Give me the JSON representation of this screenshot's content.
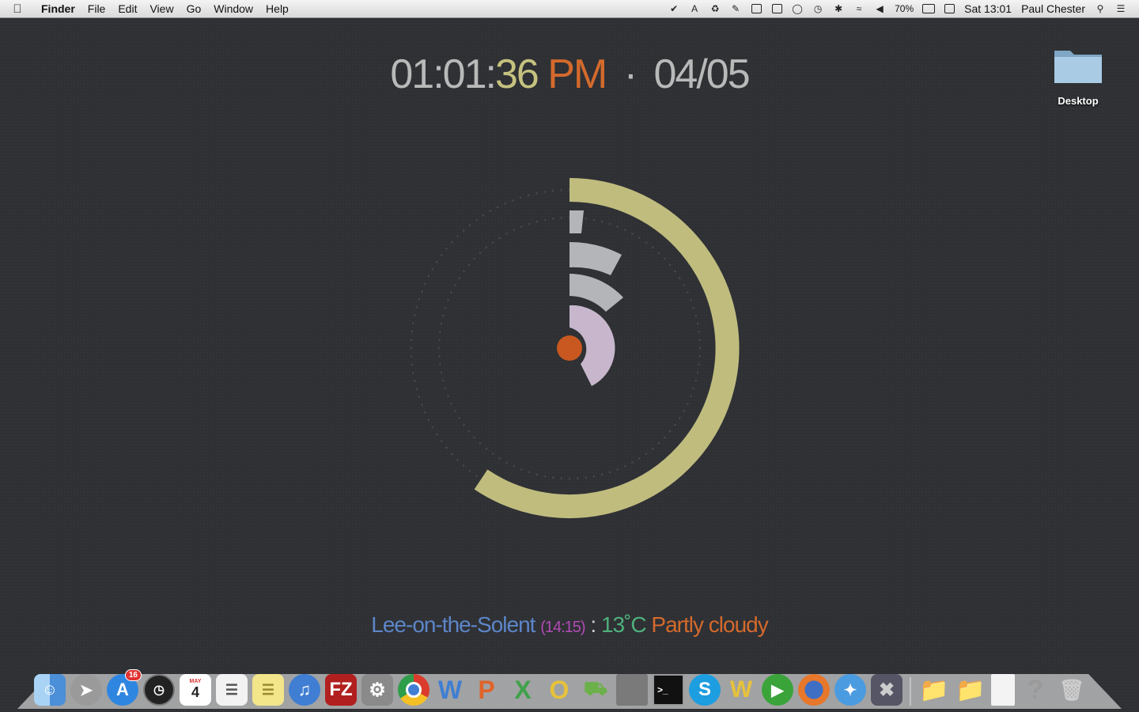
{
  "menubar": {
    "app_name": "Finder",
    "menus": [
      "File",
      "Edit",
      "View",
      "Go",
      "Window",
      "Help"
    ],
    "battery": "70%",
    "datetime": "Sat 13:01",
    "user": "Paul Chester"
  },
  "clock": {
    "hours": "01",
    "minutes": "01",
    "seconds": "36",
    "ampm": "PM",
    "separator": "·",
    "date": "04/05"
  },
  "desktop_icon": {
    "label": "Desktop"
  },
  "weather": {
    "location": "Lee-on-the-Solent",
    "time": "(14:15)",
    "separator": ":",
    "temperature": "13˚C",
    "condition": "Partly cloudy"
  },
  "dock": {
    "app_store_badge": "16",
    "calendar_day": "4",
    "calendar_month": "MAY"
  },
  "colors": {
    "background": "#2e3034",
    "seconds": "#c6c27f",
    "ampm": "#d46a2c",
    "ring_outer": "#c0bc7e",
    "wedge": "#b3b5b8",
    "wedge_pink": "#c7b6cc",
    "center_dot": "#c8581f",
    "weather_location": "#5d86c9",
    "weather_time": "#b14bb5",
    "weather_temp": "#4fb07c"
  }
}
